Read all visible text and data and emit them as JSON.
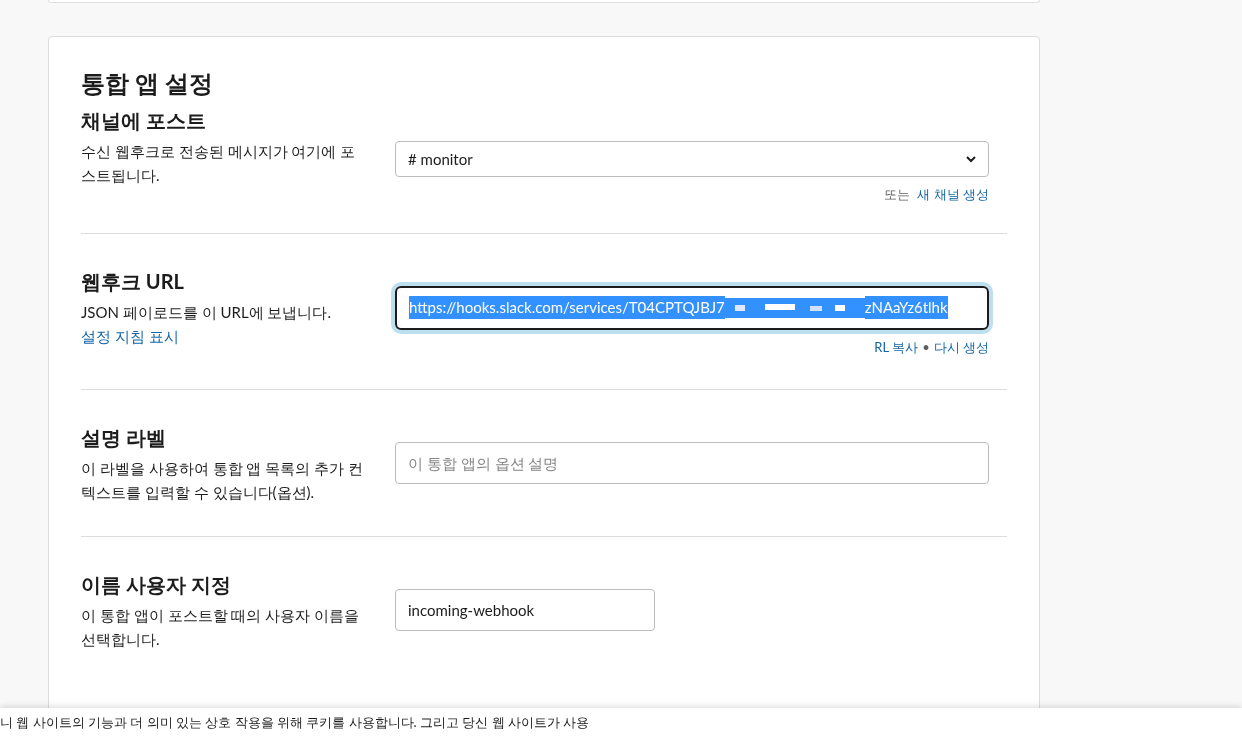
{
  "title": "통합 앱 설정",
  "sections": [
    {
      "kind": "select",
      "heading": "채널에 포스트",
      "description": "수신 웹후크로 전송된 메시지가 여기에 포스트됩니다.",
      "value": "# monitor",
      "footer": [
        {
          "text": "또는 ",
          "link": false
        },
        {
          "text": "새 채널 생성",
          "link": true
        }
      ]
    },
    {
      "kind": "url",
      "heading": "웹후크 URL",
      "description": "JSON 페이로드를 이 URL에 보냅니다.",
      "help_link": "설정 지침 표시",
      "value_start": "https://hooks.slack.com/services/T04CPTQJBJ7",
      "value_end": "zNAaYz6tlhk",
      "footer": [
        {
          "text": "RL 복사",
          "link": true
        },
        {
          "text": "•",
          "link": false
        },
        {
          "text": "다시 생성",
          "link": true
        }
      ]
    },
    {
      "kind": "text",
      "heading": "설명 라벨",
      "description": "이 라벨을 사용하여 통합 앱 목록의 추가 컨텍스트를 입력할 수 있습니다(옵션).",
      "placeholder": "이 통합 앱의 옵션 설명"
    },
    {
      "kind": "short",
      "heading": "이름 사용자 지정",
      "description": "이 통합 앱이 포스트할 때의 사용자 이름을 선택합니다.",
      "value": "incoming-webhook"
    }
  ],
  "cookie_banner": "니 웹 사이트의 기능과 더 의미 있는 상호 작용을 위해 쿠키를 사용합니다. 그리고 당신 웹 사이트가 사용"
}
